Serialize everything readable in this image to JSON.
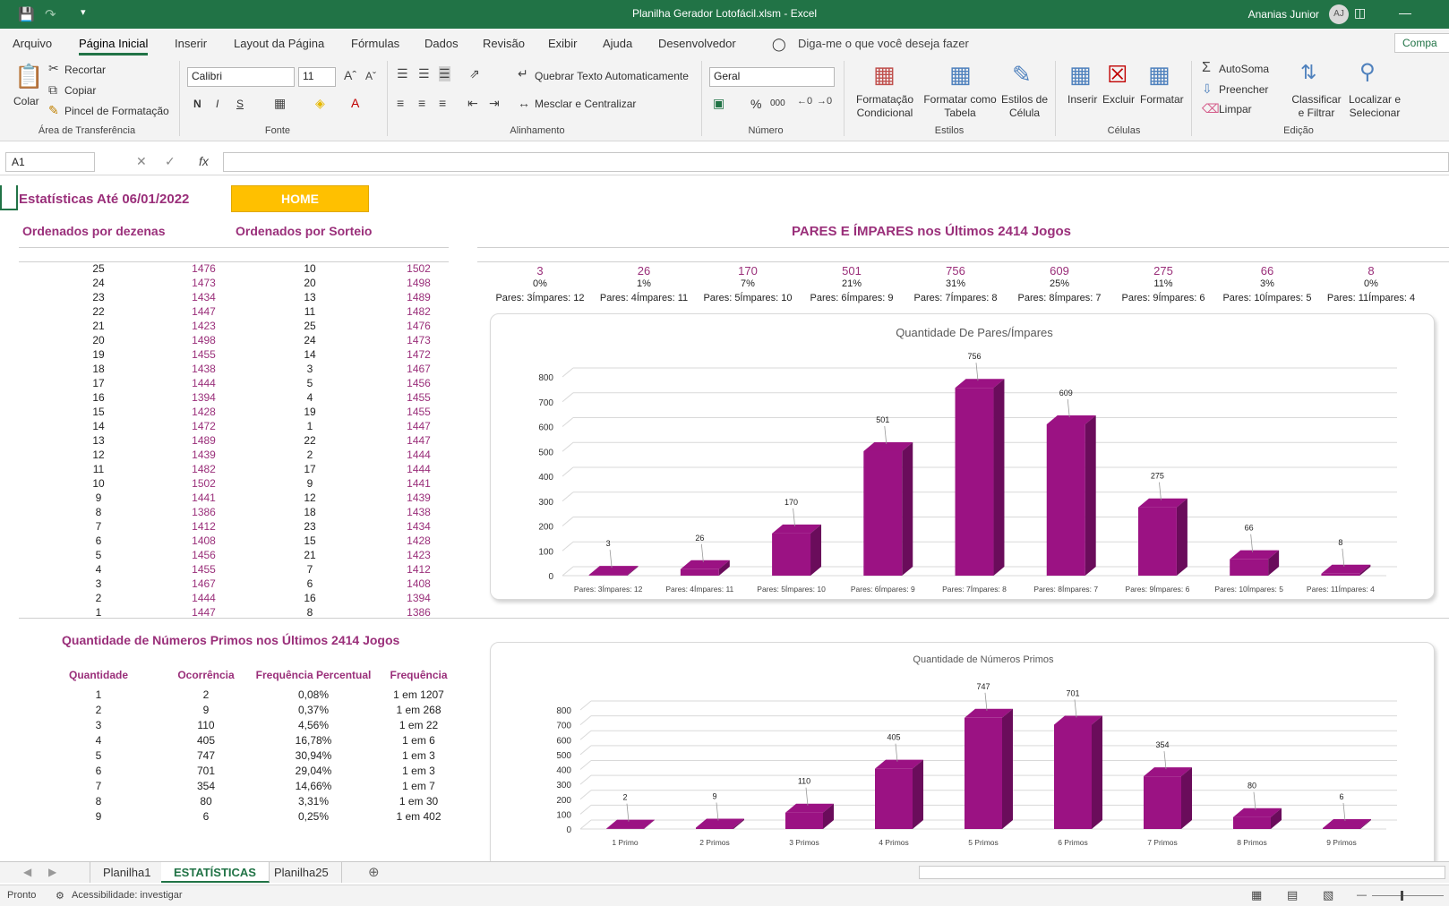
{
  "window": {
    "title": "Planilha Gerador Lotofácil.xlsm  -  Excel",
    "user": "Ananias Junior",
    "avatar": "AJ"
  },
  "menu": {
    "tabs": [
      "Arquivo",
      "Página Inicial",
      "Inserir",
      "Layout da Página",
      "Fórmulas",
      "Dados",
      "Revisão",
      "Exibir",
      "Ajuda",
      "Desenvolvedor"
    ],
    "tell_me": "Diga-me o que você deseja fazer",
    "share": "Compa"
  },
  "ribbon": {
    "clipboard": {
      "paste": "Colar",
      "cut": "Recortar",
      "copy": "Copiar",
      "format_painter": "Pincel de Formatação",
      "group": "Área de Transferência"
    },
    "font": {
      "name": "Calibri",
      "size": "11",
      "bold": "N",
      "italic": "I",
      "underline": "S",
      "group": "Fonte"
    },
    "alignment": {
      "wrap": "Quebrar Texto Automaticamente",
      "merge": "Mesclar e Centralizar",
      "group": "Alinhamento"
    },
    "number": {
      "format": "Geral",
      "percent": "%",
      "thousands": "000",
      "group": "Número"
    },
    "styles": {
      "conditional": "Formatação\nCondicional",
      "table": "Formatar como\nTabela",
      "cell": "Estilos de\nCélula",
      "group": "Estilos"
    },
    "cells": {
      "insert": "Inserir",
      "delete": "Excluir",
      "format": "Formatar",
      "group": "Células"
    },
    "editing": {
      "autosum": "AutoSoma",
      "fill": "Preencher",
      "clear": "Limpar",
      "sort": "Classificar\ne Filtrar",
      "find": "Localizar e\nSelecionar",
      "group": "Edição"
    }
  },
  "formula_bar": {
    "cell_ref": "A1",
    "fx": "fx",
    "value": ""
  },
  "sheet": {
    "title": "Estatísticas Até 06/01/2022",
    "home_button": "HOME",
    "ordered_dezenas_header": "Ordenados por dezenas",
    "ordered_sorteio_header": "Ordenados por Sorteio",
    "dezenas": [
      [
        "25",
        "1476"
      ],
      [
        "24",
        "1473"
      ],
      [
        "23",
        "1434"
      ],
      [
        "22",
        "1447"
      ],
      [
        "21",
        "1423"
      ],
      [
        "20",
        "1498"
      ],
      [
        "19",
        "1455"
      ],
      [
        "18",
        "1438"
      ],
      [
        "17",
        "1444"
      ],
      [
        "16",
        "1394"
      ],
      [
        "15",
        "1428"
      ],
      [
        "14",
        "1472"
      ],
      [
        "13",
        "1489"
      ],
      [
        "12",
        "1439"
      ],
      [
        "11",
        "1482"
      ],
      [
        "10",
        "1502"
      ],
      [
        "9",
        "1441"
      ],
      [
        "8",
        "1386"
      ],
      [
        "7",
        "1412"
      ],
      [
        "6",
        "1408"
      ],
      [
        "5",
        "1456"
      ],
      [
        "4",
        "1455"
      ],
      [
        "3",
        "1467"
      ],
      [
        "2",
        "1444"
      ],
      [
        "1",
        "1447"
      ]
    ],
    "sorteio": [
      [
        "10",
        "1502"
      ],
      [
        "20",
        "1498"
      ],
      [
        "13",
        "1489"
      ],
      [
        "11",
        "1482"
      ],
      [
        "25",
        "1476"
      ],
      [
        "24",
        "1473"
      ],
      [
        "14",
        "1472"
      ],
      [
        "3",
        "1467"
      ],
      [
        "5",
        "1456"
      ],
      [
        "4",
        "1455"
      ],
      [
        "19",
        "1455"
      ],
      [
        "1",
        "1447"
      ],
      [
        "22",
        "1447"
      ],
      [
        "2",
        "1444"
      ],
      [
        "17",
        "1444"
      ],
      [
        "9",
        "1441"
      ],
      [
        "12",
        "1439"
      ],
      [
        "18",
        "1438"
      ],
      [
        "23",
        "1434"
      ],
      [
        "15",
        "1428"
      ],
      [
        "21",
        "1423"
      ],
      [
        "7",
        "1412"
      ],
      [
        "6",
        "1408"
      ],
      [
        "16",
        "1394"
      ],
      [
        "8",
        "1386"
      ]
    ],
    "pares_header": "PARES E ÍMPARES nos Últimos 2414 Jogos",
    "pares": [
      {
        "count": "3",
        "pct": "0%",
        "label": "Pares: 3Ímpares: 12"
      },
      {
        "count": "26",
        "pct": "1%",
        "label": "Pares: 4Ímpares: 11"
      },
      {
        "count": "170",
        "pct": "7%",
        "label": "Pares: 5Ímpares: 10"
      },
      {
        "count": "501",
        "pct": "21%",
        "label": "Pares: 6Ímpares: 9"
      },
      {
        "count": "756",
        "pct": "31%",
        "label": "Pares: 7Ímpares: 8"
      },
      {
        "count": "609",
        "pct": "25%",
        "label": "Pares: 8Ímpares: 7"
      },
      {
        "count": "275",
        "pct": "11%",
        "label": "Pares: 9Ímpares: 6"
      },
      {
        "count": "66",
        "pct": "3%",
        "label": "Pares: 10Ímpares: 5"
      },
      {
        "count": "8",
        "pct": "0%",
        "label": "Pares: 11Ímpares: 4"
      }
    ],
    "primos_header": "Quantidade de Números Primos nos Últimos 2414 Jogos",
    "primos_columns": [
      "Quantidade",
      "Ocorrência",
      "Frequência Percentual",
      "Frequência"
    ],
    "primos_rows": [
      [
        "1",
        "2",
        "0,08%",
        "1 em 1207"
      ],
      [
        "2",
        "9",
        "0,37%",
        "1 em 268"
      ],
      [
        "3",
        "110",
        "4,56%",
        "1 em 22"
      ],
      [
        "4",
        "405",
        "16,78%",
        "1 em 6"
      ],
      [
        "5",
        "747",
        "30,94%",
        "1 em 3"
      ],
      [
        "6",
        "701",
        "29,04%",
        "1 em 3"
      ],
      [
        "7",
        "354",
        "14,66%",
        "1 em 7"
      ],
      [
        "8",
        "80",
        "3,31%",
        "1 em 30"
      ],
      [
        "9",
        "6",
        "0,25%",
        "1 em 402"
      ]
    ]
  },
  "chart_data": [
    {
      "type": "bar",
      "title": "Quantidade De Pares/Ímpares",
      "categories": [
        "Pares: 3Ímpares: 12",
        "Pares: 4Ímpares: 11",
        "Pares: 5Ímpares: 10",
        "Pares: 6Ímpares: 9",
        "Pares: 7Ímpares: 8",
        "Pares: 8Ímpares: 7",
        "Pares: 9Ímpares: 6",
        "Pares: 10Ímpares: 5",
        "Pares: 11Ímpares: 4"
      ],
      "values": [
        3,
        26,
        170,
        501,
        756,
        609,
        275,
        66,
        8
      ],
      "yticks": [
        "0",
        "100",
        "200",
        "300",
        "400",
        "500",
        "600",
        "700",
        "800"
      ],
      "ylim": [
        0,
        800
      ],
      "grid": true,
      "color": "#9b1283",
      "dark": "#6a0c5b"
    },
    {
      "type": "bar",
      "title": "Quantidade de Números Primos",
      "categories": [
        "1 Primo",
        "2 Primos",
        "3 Primos",
        "4 Primos",
        "5 Primos",
        "6 Primos",
        "7 Primos",
        "8 Primos",
        "9 Primos"
      ],
      "values": [
        2,
        9,
        110,
        405,
        747,
        701,
        354,
        80,
        6
      ],
      "yticks": [
        "0",
        "100",
        "200",
        "300",
        "400",
        "500",
        "600",
        "700",
        "800"
      ],
      "ylim": [
        0,
        800
      ],
      "grid": true,
      "color": "#9b1283",
      "dark": "#6a0c5b"
    }
  ],
  "sheet_tabs": [
    "Planilha1",
    "ESTATÍSTICAS",
    "Planilha25"
  ],
  "status": {
    "ready": "Pronto",
    "accessibility": "Acessibilidade: investigar"
  }
}
